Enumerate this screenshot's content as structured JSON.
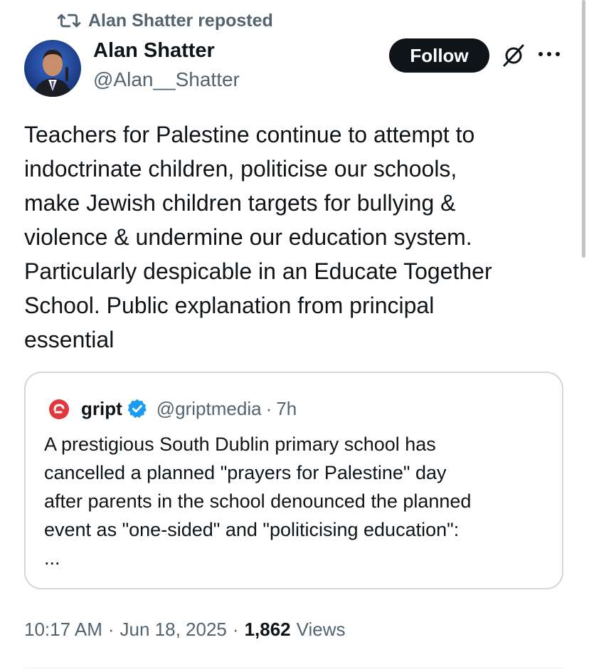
{
  "repost": {
    "text": "Alan Shatter reposted",
    "icon": "repost-icon"
  },
  "author": {
    "name": "Alan Shatter",
    "handle": "@Alan__Shatter"
  },
  "actions": {
    "follow_label": "Follow",
    "grok_icon": "grok-icon",
    "more_icon": "more-icon"
  },
  "tweet": {
    "lines": [
      "Teachers for Palestine continue to attempt to",
      "indoctrinate children, politicise our schools,",
      "make Jewish children targets for bullying &",
      "violence & undermine our education system.",
      "Particularly despicable in an Educate Together",
      "School.  Public explanation from principal",
      "essential"
    ]
  },
  "quote": {
    "name": "gript",
    "handle": "@griptmedia",
    "separator": "·",
    "time": "7h",
    "verified_icon": "verified-badge-icon",
    "lines": [
      "A prestigious South Dublin primary school has",
      "cancelled a planned \"prayers for Palestine\" day",
      "after parents in the school denounced the planned",
      "event as \"one-sided\" and \"politicising education\":",
      "..."
    ]
  },
  "meta": {
    "time": "10:17 AM",
    "sep1": "·",
    "date": "Jun 18, 2025",
    "sep2": "·",
    "views_count": "1,862",
    "views_label": "Views"
  },
  "colors": {
    "text": "#0f1419",
    "muted": "#536471",
    "border": "#cfd9de",
    "follow_bg": "#0f1419",
    "verified": "#1d9bf0",
    "gript_red": "#e0383e"
  }
}
